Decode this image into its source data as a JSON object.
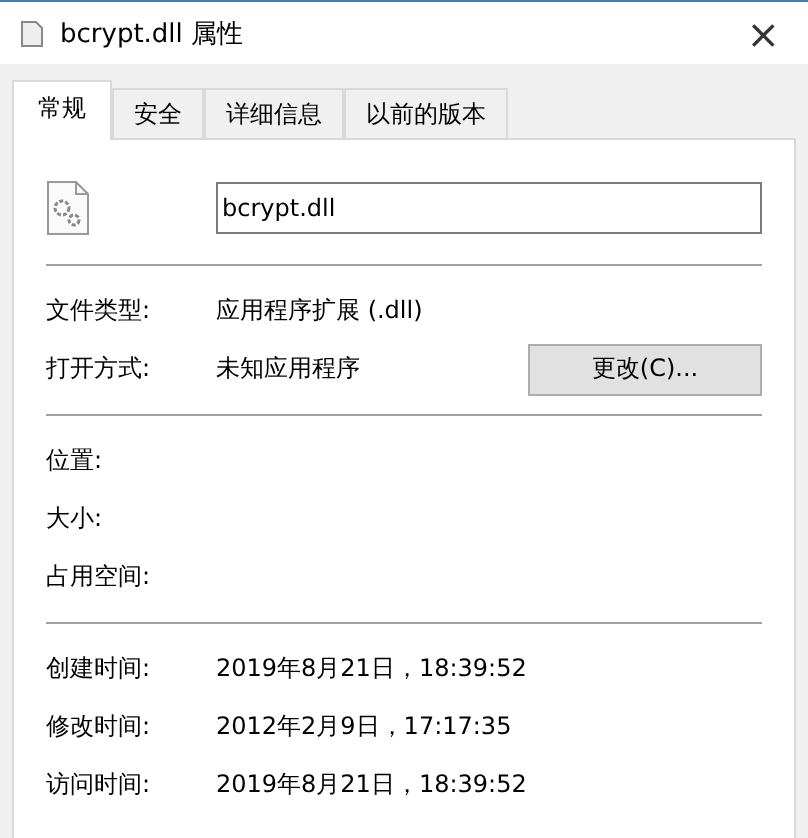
{
  "window": {
    "title": "bcrypt.dll 属性",
    "close": "×"
  },
  "tabs": [
    {
      "label": "常规",
      "selected": true
    },
    {
      "label": "安全",
      "selected": false
    },
    {
      "label": "详细信息",
      "selected": false
    },
    {
      "label": "以前的版本",
      "selected": false
    }
  ],
  "file_name": {
    "value": "bcrypt.dll"
  },
  "sections": [
    {
      "rows": [
        {
          "label": "文件类型:",
          "value": "应用程序扩展 (.dll)"
        },
        {
          "label": "打开方式:",
          "value": "未知应用程序",
          "button": "更改(C)..."
        }
      ]
    },
    {
      "rows": [
        {
          "label": "位置:"
        },
        {
          "label": "大小:"
        },
        {
          "label": "占用空间:"
        }
      ]
    },
    {
      "rows": [
        {
          "label": "创建时间:",
          "value": "2019年8月21日，18:39:52"
        },
        {
          "label": "修改时间:",
          "value": "2012年2月9日，17:17:35"
        },
        {
          "label": "访问时间:",
          "value": "2019年8月21日，18:39:52"
        }
      ]
    }
  ]
}
